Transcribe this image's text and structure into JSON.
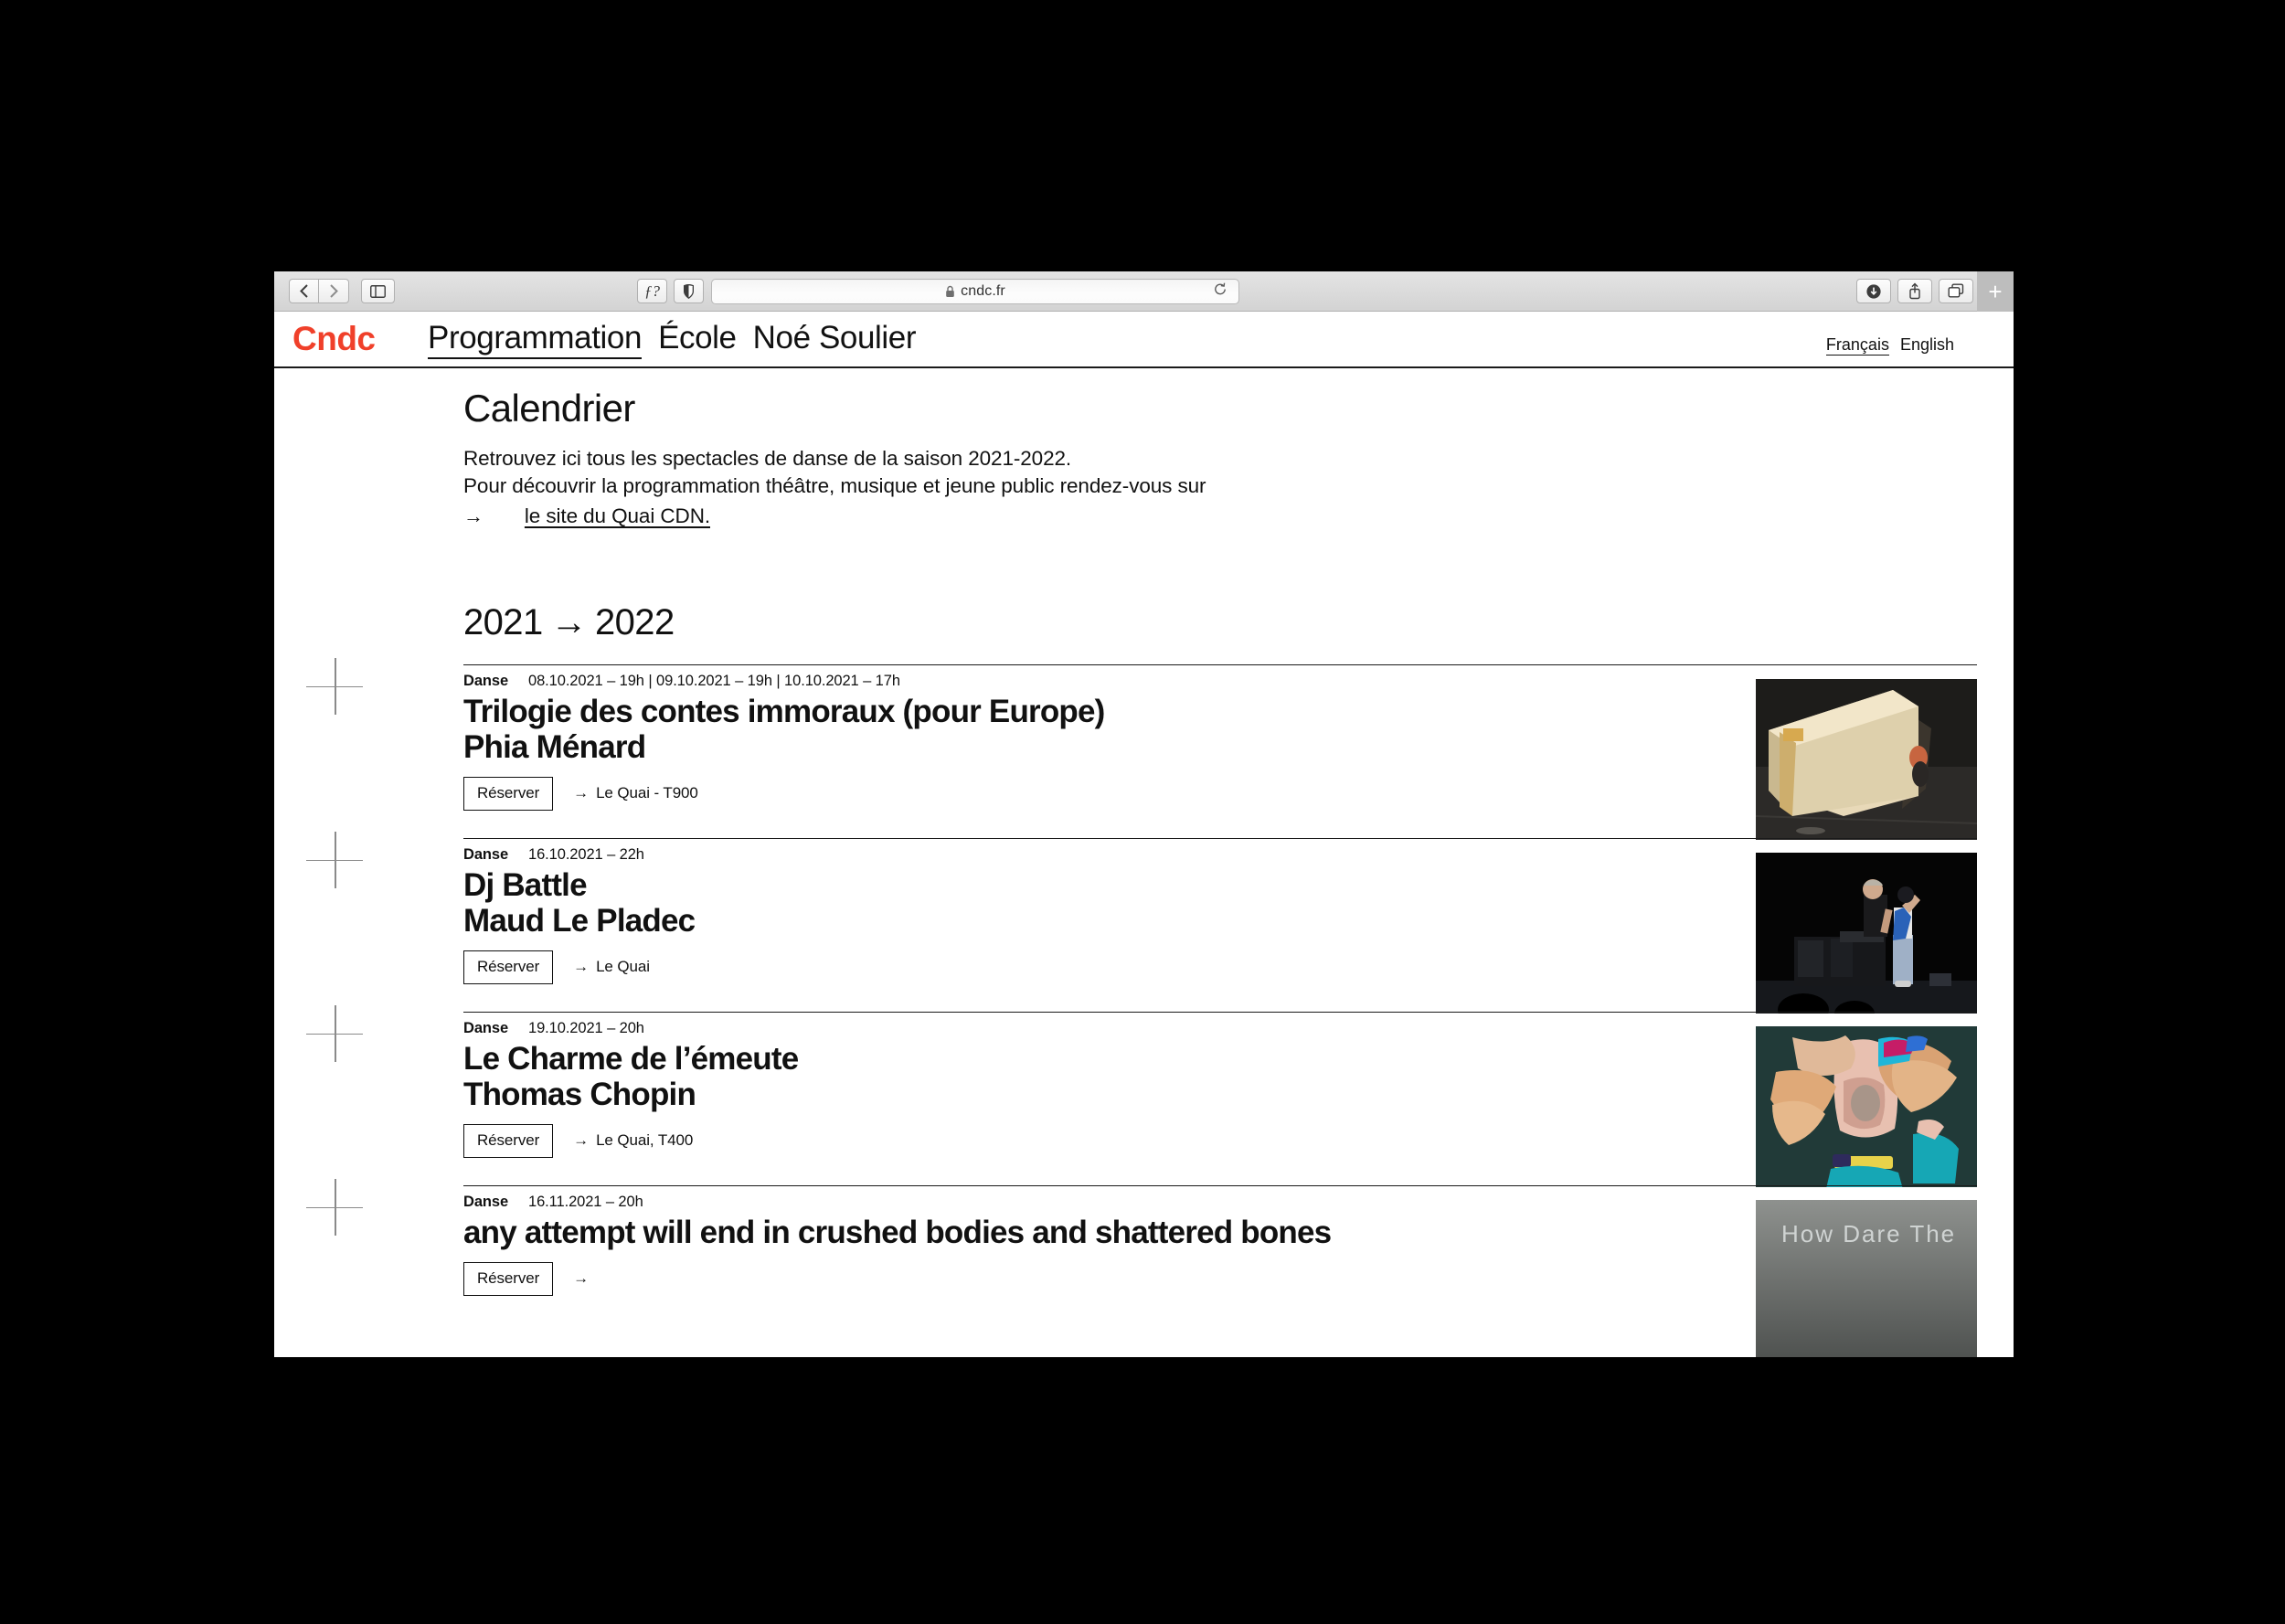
{
  "browser": {
    "url": "cndc.fr",
    "lock_icon": "lock-icon",
    "back_icon": "chevron-left-icon",
    "forward_icon": "chevron-right-icon",
    "sidebar_icon": "sidebar-icon",
    "reader_icon": "reader-font-icon",
    "privacy_icon": "shield-icon",
    "reload_icon": "reload-icon",
    "download_icon": "download-icon",
    "share_icon": "share-icon",
    "tabs_icon": "tab-overview-icon",
    "new_tab_label": "+"
  },
  "site": {
    "logo": "Cndc",
    "nav": [
      {
        "label": "Programmation",
        "active": true
      },
      {
        "label": "École",
        "active": false
      },
      {
        "label": "Noé Soulier",
        "active": false
      }
    ],
    "languages": [
      {
        "label": "Français",
        "active": true
      },
      {
        "label": "English",
        "active": false
      }
    ]
  },
  "main": {
    "title": "Calendrier",
    "intro_line1": "Retrouvez ici tous les spectacles de danse de la saison 2021-2022.",
    "intro_line2": "Pour découvrir la programmation théâtre, musique et jeune public rendez-vous sur",
    "intro_arrow": "→",
    "intro_link": "le site du Quai CDN.",
    "season_from": "2021",
    "season_arrow": "→",
    "season_to": "2022"
  },
  "events": [
    {
      "category": "Danse",
      "dates": "08.10.2021 – 19h | 09.10.2021 – 19h | 10.10.2021 – 17h",
      "title": "Trilogie des contes immoraux (pour Europe)",
      "artist": "Phia Ménard",
      "reserve_label": "Réserver",
      "venue_arrow": "→",
      "venue": "Le Quai - T900",
      "image_alt": "cardboard-structure-on-stage"
    },
    {
      "category": "Danse",
      "dates": "16.10.2021 – 22h",
      "title": "Dj Battle",
      "artist": "Maud Le Pladec",
      "reserve_label": "Réserver",
      "venue_arrow": "→",
      "venue": "Le Quai",
      "image_alt": "dj-and-dancer-on-dark-stage"
    },
    {
      "category": "Danse",
      "dates": "19.10.2021 – 20h",
      "title": "Le Charme de l’émeute",
      "artist": "Thomas Chopin",
      "reserve_label": "Réserver",
      "venue_arrow": "→",
      "venue": "Le Quai, T400",
      "image_alt": "dancer-with-orange-fabric"
    },
    {
      "category": "Danse",
      "dates": "16.11.2021 – 20h",
      "title": "any attempt will end in crushed bodies and shattered bones",
      "artist": "",
      "reserve_label": "Réserver",
      "venue_arrow": "→",
      "venue": "",
      "image_alt": "how-dare-they-video-still",
      "image_caption": "How Dare The"
    }
  ],
  "colors": {
    "brand_red": "#f0402a",
    "text": "#111111",
    "rule": "#1a1a1a"
  }
}
